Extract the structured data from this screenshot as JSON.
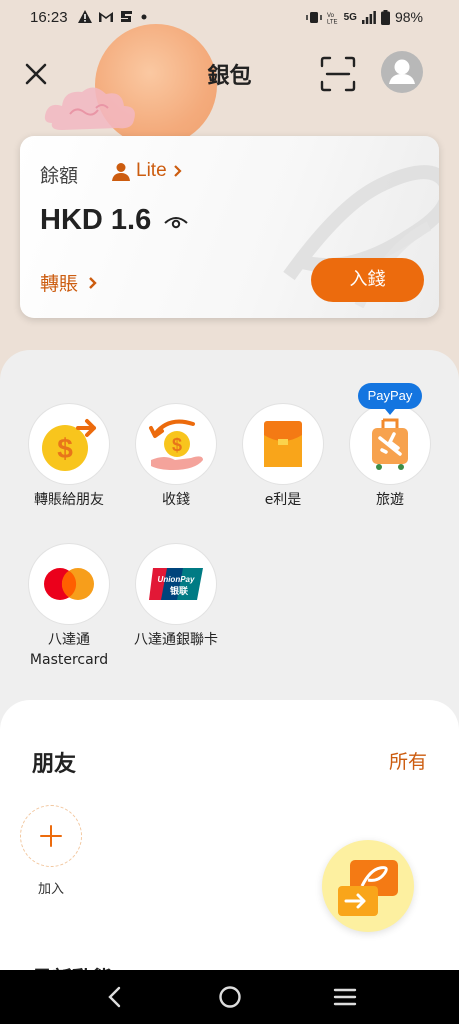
{
  "status_bar": {
    "time": "16:23",
    "network": "5G",
    "battery": "98%"
  },
  "header": {
    "title": "銀包"
  },
  "balance_card": {
    "label": "餘額",
    "tier": "Lite",
    "amount": "HKD 1.6",
    "transfer_label": "轉賬",
    "topup_label": "入錢"
  },
  "services": {
    "transfer_friend": "轉賬給朋友",
    "receive": "收錢",
    "e_lai_see": "e利是",
    "travel": "旅遊",
    "travel_badge": "PayPay",
    "mastercard": "八達通\nMastercard",
    "unionpay": "八達通銀聯卡",
    "unionpay_logo_text": "UnionPay 银联"
  },
  "friends": {
    "title": "朋友",
    "all_label": "所有",
    "add_label": "加入",
    "next_section_peek": "最新動態"
  },
  "colors": {
    "accent": "#ec6b0d",
    "accent_text": "#cc5c0f",
    "paypay": "#1475e0"
  }
}
